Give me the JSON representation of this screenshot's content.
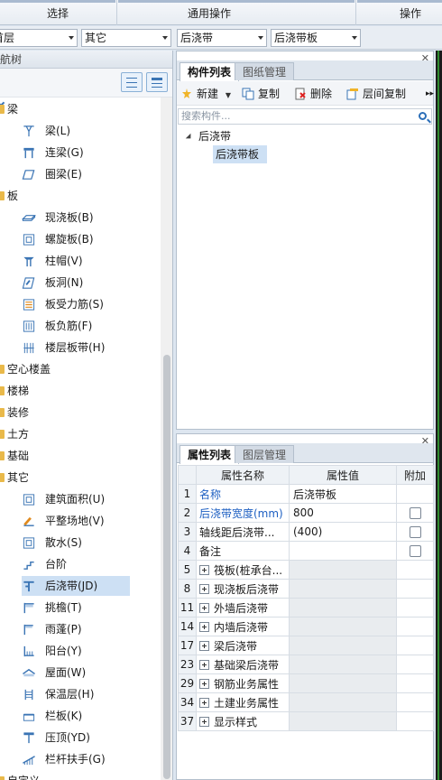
{
  "ribbon": {
    "groups": [
      "选择",
      "通用操作",
      "操作"
    ]
  },
  "selectors": {
    "floor": "首层",
    "category": "其它",
    "component_type": "后浇带",
    "component_name": "后浇带板"
  },
  "nav": {
    "title": "导航树",
    "tree": [
      {
        "type": "cat",
        "label": "梁"
      },
      {
        "type": "item",
        "label": "梁(L)",
        "icon": "beam-icon"
      },
      {
        "type": "item",
        "label": "连梁(G)",
        "icon": "coupling-beam-icon"
      },
      {
        "type": "item",
        "label": "圈梁(E)",
        "icon": "ring-beam-icon"
      },
      {
        "type": "cat",
        "label": "板"
      },
      {
        "type": "item",
        "label": "现浇板(B)",
        "icon": "slab-icon"
      },
      {
        "type": "item",
        "label": "螺旋板(B)",
        "icon": "spiral-slab-icon"
      },
      {
        "type": "item",
        "label": "柱帽(V)",
        "icon": "column-cap-icon"
      },
      {
        "type": "item",
        "label": "板洞(N)",
        "icon": "slab-hole-icon"
      },
      {
        "type": "item",
        "label": "板受力筋(S)",
        "icon": "slab-rebar-icon"
      },
      {
        "type": "item",
        "label": "板负筋(F)",
        "icon": "negative-rebar-icon"
      },
      {
        "type": "item",
        "label": "楼层板带(H)",
        "icon": "slab-strip-icon"
      },
      {
        "type": "cat",
        "label": "空心楼盖"
      },
      {
        "type": "cat",
        "label": "楼梯"
      },
      {
        "type": "cat",
        "label": "装修"
      },
      {
        "type": "cat",
        "label": "土方"
      },
      {
        "type": "cat",
        "label": "基础"
      },
      {
        "type": "cat",
        "label": "其它"
      },
      {
        "type": "item",
        "label": "建筑面积(U)",
        "icon": "building-area-icon"
      },
      {
        "type": "item",
        "label": "平整场地(V)",
        "icon": "site-leveling-icon"
      },
      {
        "type": "item",
        "label": "散水(S)",
        "icon": "apron-icon"
      },
      {
        "type": "item",
        "label": "台阶",
        "icon": "step-icon"
      },
      {
        "type": "item",
        "label": "后浇带(JD)",
        "icon": "post-cast-strip-icon",
        "selected": true
      },
      {
        "type": "item",
        "label": "挑檐(T)",
        "icon": "eave-icon"
      },
      {
        "type": "item",
        "label": "雨蓬(P)",
        "icon": "canopy-icon"
      },
      {
        "type": "item",
        "label": "阳台(Y)",
        "icon": "balcony-icon"
      },
      {
        "type": "item",
        "label": "屋面(W)",
        "icon": "roof-icon"
      },
      {
        "type": "item",
        "label": "保温层(H)",
        "icon": "insulation-icon"
      },
      {
        "type": "item",
        "label": "栏板(K)",
        "icon": "parapet-icon"
      },
      {
        "type": "item",
        "label": "压顶(YD)",
        "icon": "coping-icon"
      },
      {
        "type": "item",
        "label": "栏杆扶手(G)",
        "icon": "railing-icon"
      },
      {
        "type": "cat",
        "label": "自定义"
      }
    ]
  },
  "component_panel": {
    "tabs": [
      "构件列表",
      "图纸管理"
    ],
    "toolbar": {
      "new": "新建",
      "copy": "复制",
      "delete": "删除",
      "floor_copy": "层间复制"
    },
    "search_placeholder": "搜索构件...",
    "tree_root": "后浇带",
    "tree_child": "后浇带板"
  },
  "property_panel": {
    "tabs": [
      "属性列表",
      "图层管理"
    ],
    "headers": [
      "属性名称",
      "属性值",
      "附加"
    ],
    "rows": [
      {
        "num": "1",
        "name": "名称",
        "value": "后浇带板",
        "blue": true,
        "check": false,
        "group": false
      },
      {
        "num": "2",
        "name": "后浇带宽度(mm)",
        "value": "800",
        "blue": true,
        "check": true,
        "group": false
      },
      {
        "num": "3",
        "name": "轴线距后浇带...",
        "value": "(400)",
        "blue": false,
        "check": true,
        "group": false
      },
      {
        "num": "4",
        "name": "备注",
        "value": "",
        "blue": false,
        "check": true,
        "group": false
      },
      {
        "num": "5",
        "name": "筏板(桩承台...",
        "value": "",
        "group": true
      },
      {
        "num": "8",
        "name": "现浇板后浇带",
        "value": "",
        "group": true
      },
      {
        "num": "11",
        "name": "外墙后浇带",
        "value": "",
        "group": true
      },
      {
        "num": "14",
        "name": "内墙后浇带",
        "value": "",
        "group": true
      },
      {
        "num": "17",
        "name": "梁后浇带",
        "value": "",
        "group": true
      },
      {
        "num": "23",
        "name": "基础梁后浇带",
        "value": "",
        "group": true
      },
      {
        "num": "29",
        "name": "钢筋业务属性",
        "value": "",
        "group": true
      },
      {
        "num": "34",
        "name": "土建业务属性",
        "value": "",
        "group": true
      },
      {
        "num": "37",
        "name": "显示样式",
        "value": "",
        "group": true
      }
    ]
  }
}
